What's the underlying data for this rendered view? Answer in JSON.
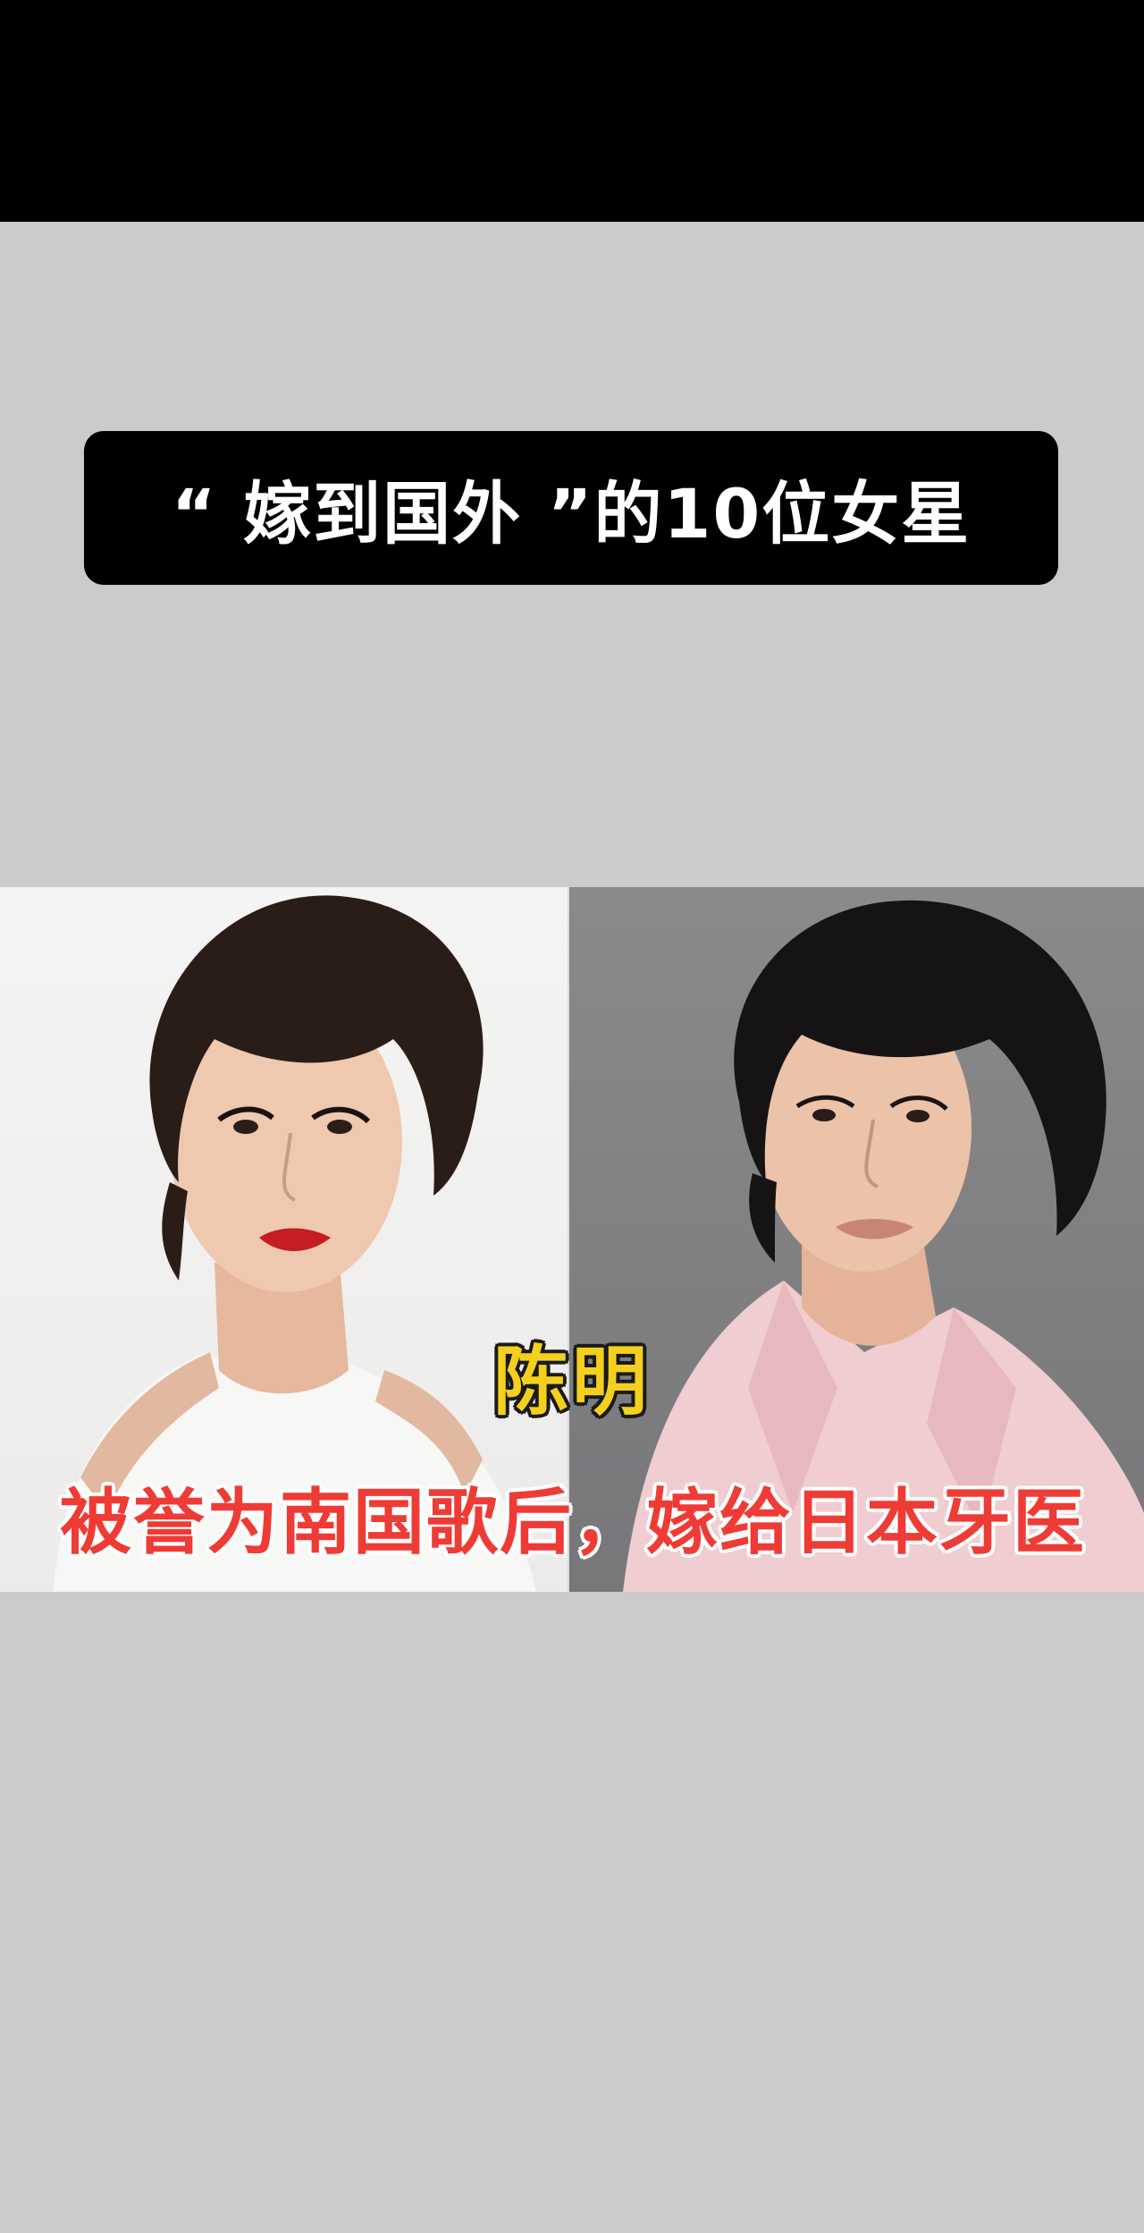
{
  "title_banner": {
    "text": "“ 嫁到国外 ”的10位女星"
  },
  "captions": {
    "name": "陈明",
    "subtitle": "被誉为南国歌后，嫁给日本牙医"
  },
  "colors": {
    "background": "#cbcbcb",
    "top_bar": "#000000",
    "banner_bg": "#000000",
    "banner_text": "#ffffff",
    "name_text": "#f4d01e",
    "subtitle_text": "#ef3b35"
  }
}
